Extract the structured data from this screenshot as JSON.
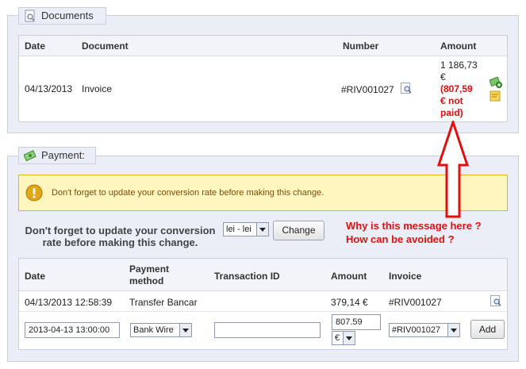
{
  "documents": {
    "legend": "Documents",
    "headers": {
      "date": "Date",
      "document": "Document",
      "number": "Number",
      "amount": "Amount"
    },
    "row": {
      "date": "04/13/2013",
      "document": "Invoice",
      "number": "#RIV001027",
      "amount_line1": "1 186,73",
      "amount_line2": "€",
      "unpaid_line1": "(807,59",
      "unpaid_line2": "€ not",
      "unpaid_line3": "paid)"
    }
  },
  "payment": {
    "legend": "Payment:",
    "warning": "Don't forget to update your conversion rate before making this change.",
    "conversion_text_line1": "Don't forget to update your conversion",
    "conversion_text_line2": "rate before making this change.",
    "currency_select": "lei - lei",
    "change_button": "Change",
    "headers": {
      "date": "Date",
      "method_line1": "Payment",
      "method_line2": "method",
      "transaction": "Transaction ID",
      "amount": "Amount",
      "invoice": "Invoice"
    },
    "row": {
      "date": "04/13/2013 12:58:39",
      "method": "Transfer Bancar",
      "transaction": "",
      "amount": "379,14 €",
      "invoice": "#RIV001027"
    },
    "form": {
      "date_value": "2013-04-13 13:00:00",
      "method_value": "Bank Wire",
      "transaction_value": "",
      "amount_value": "807.59",
      "currency_value": "€",
      "invoice_value": "#RIV001027",
      "add_button": "Add"
    }
  },
  "annotation": {
    "line1": "Why is this message here ?",
    "line2": "How can be avoided ?",
    "color": "#e01010"
  }
}
